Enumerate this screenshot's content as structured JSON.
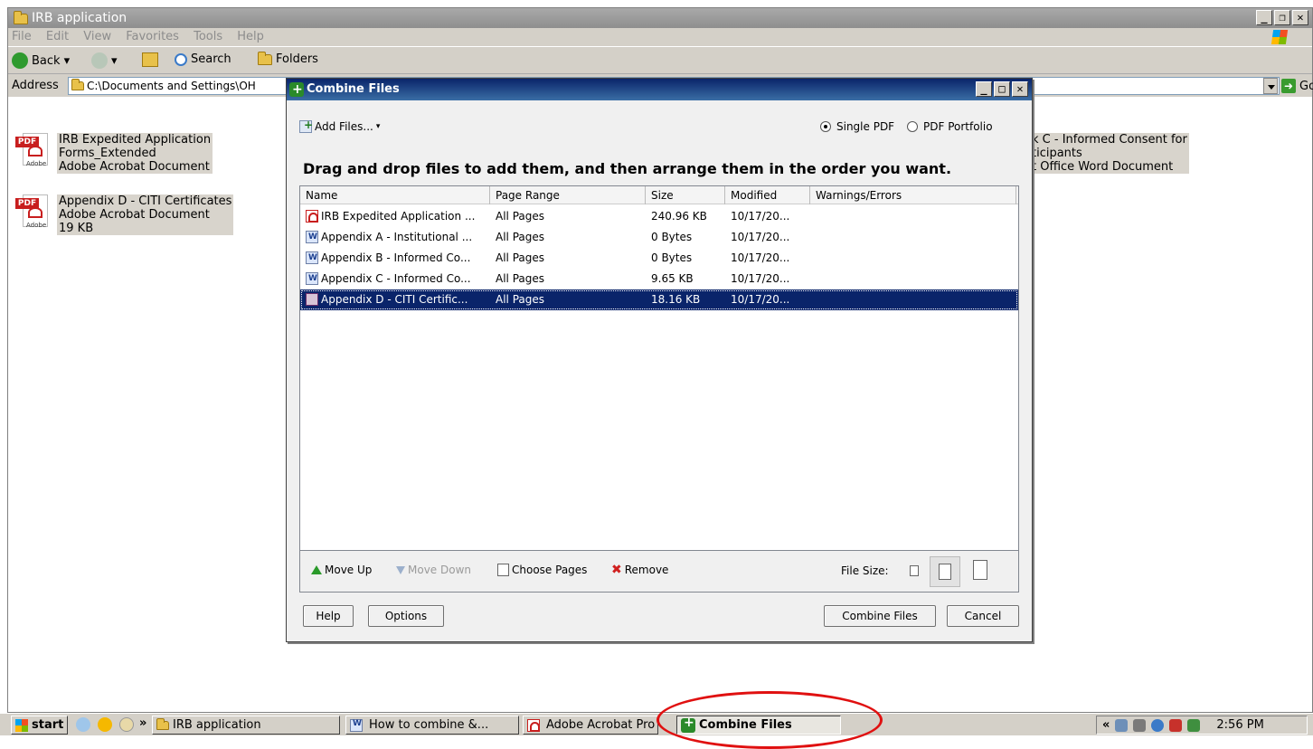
{
  "explorer": {
    "title": "IRB application",
    "menu": [
      "File",
      "Edit",
      "View",
      "Favorites",
      "Tools",
      "Help"
    ],
    "toolbar": {
      "back": "Back",
      "search": "Search",
      "folders": "Folders"
    },
    "address_label": "Address",
    "address_value": "C:\\Documents and Settings\\OH",
    "go": "Go",
    "files": [
      {
        "lines": [
          "IRB Expedited Application",
          "Forms_Extended",
          "Adobe Acrobat Document"
        ]
      },
      {
        "lines": [
          "Appendix D - CITI Certificates",
          "Adobe Acrobat Document",
          "19 KB"
        ]
      },
      {
        "lines": [
          "k C - Informed Consent for",
          "ticipants",
          "t Office Word Document"
        ]
      }
    ]
  },
  "dialog": {
    "title": "Combine Files",
    "add_files": "Add Files...",
    "radio_single": "Single PDF",
    "radio_portfolio": "PDF Portfolio",
    "instruction": "Drag and drop files to add them, and then arrange them in the order you want.",
    "columns": [
      "Name",
      "Page Range",
      "Size",
      "Modified",
      "Warnings/Errors"
    ],
    "rows": [
      {
        "name": "IRB Expedited Application ...",
        "range": "All Pages",
        "size": "240.96 KB",
        "modified": "10/17/20...",
        "type": "pdf"
      },
      {
        "name": "Appendix A - Institutional ...",
        "range": "All Pages",
        "size": "0 Bytes",
        "modified": "10/17/20...",
        "type": "word"
      },
      {
        "name": "Appendix B - Informed Co...",
        "range": "All Pages",
        "size": "0 Bytes",
        "modified": "10/17/20...",
        "type": "word"
      },
      {
        "name": "Appendix C - Informed Co...",
        "range": "All Pages",
        "size": "9.65 KB",
        "modified": "10/17/20...",
        "type": "word"
      },
      {
        "name": "Appendix D - CITI Certific...",
        "range": "All Pages",
        "size": "18.16 KB",
        "modified": "10/17/20...",
        "type": "mixed"
      }
    ],
    "selected_row": 4,
    "actions": {
      "move_up": "Move Up",
      "move_down": "Move Down",
      "choose_pages": "Choose Pages",
      "remove": "Remove"
    },
    "file_size_label": "File Size:",
    "buttons": {
      "help": "Help",
      "options": "Options",
      "combine": "Combine Files",
      "cancel": "Cancel"
    }
  },
  "taskbar": {
    "start": "start",
    "overflow": "»",
    "tasks": [
      "IRB application",
      "How to combine &...",
      "Adobe Acrobat Pro",
      "Combine Files"
    ],
    "tray_chevron": "«",
    "clock": "2:56 PM"
  },
  "colors": {
    "selection": "#0a246a",
    "dialog_title": "#0a246a",
    "highlight": "#e01010"
  }
}
